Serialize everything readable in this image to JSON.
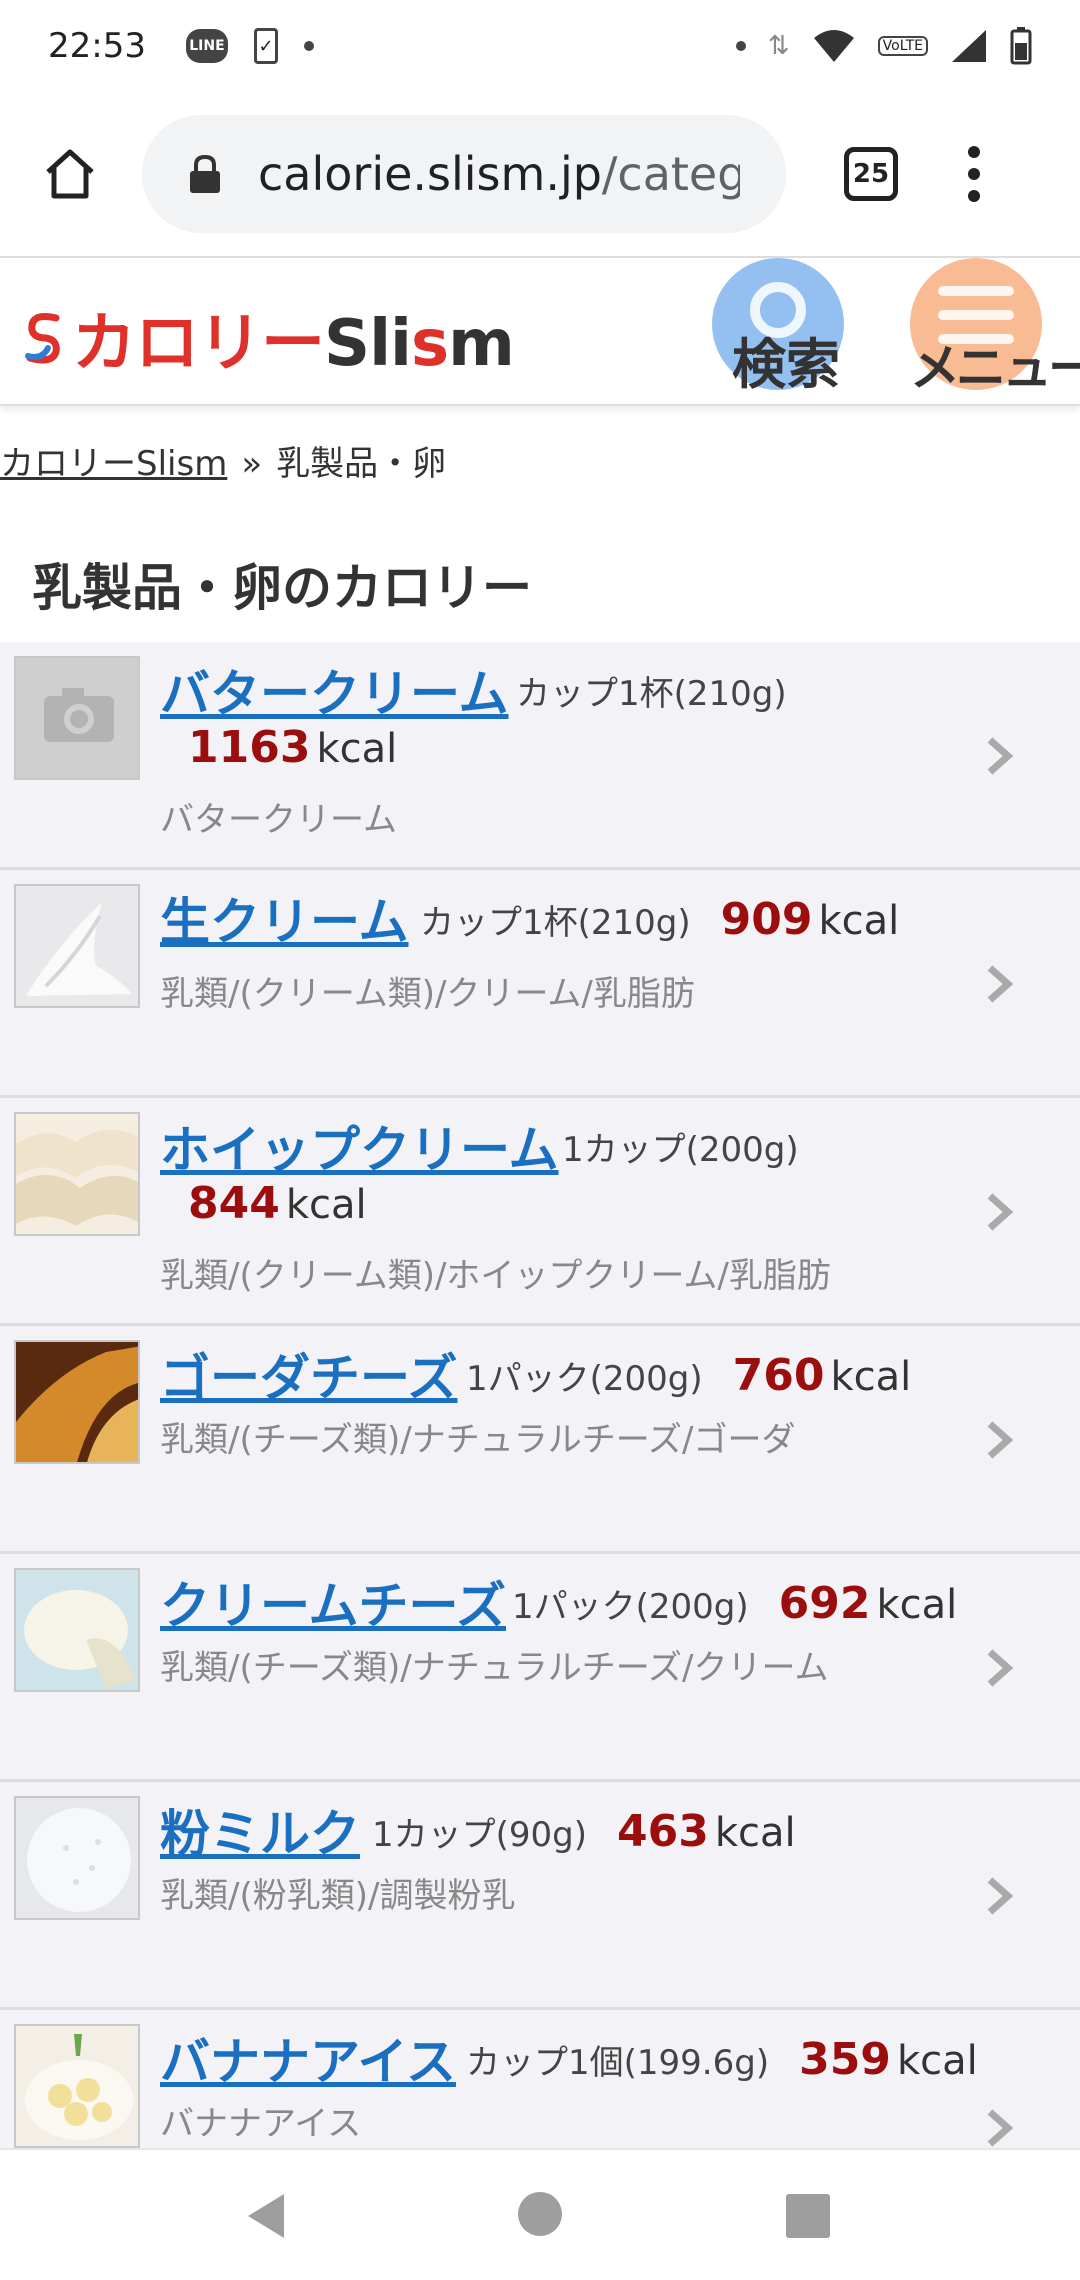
{
  "status_bar": {
    "time": "22:53",
    "icons": [
      "line-app-icon",
      "phone-check-icon",
      "dot-icon",
      "data-arrows-icon",
      "wifi-icon",
      "volte-icon",
      "signal-icon",
      "battery-icon"
    ],
    "volte_label": "VoLTE"
  },
  "browser": {
    "url_host": "calorie.slism.jp",
    "url_path": "/catego",
    "tab_count": "25"
  },
  "site": {
    "logo_kana": "カロリー",
    "logo_latin_pre": "Sli",
    "logo_latin_accent": "s",
    "logo_latin_post": "m",
    "search_label": "検索",
    "menu_label": "メニュー"
  },
  "breadcrumb": {
    "home": "カロリーSlism",
    "separator": "»",
    "current": "乳製品・卵"
  },
  "page_title": "乳製品・卵のカロリー",
  "items": [
    {
      "name": "バタークリーム",
      "portion": "カップ1杯(210g)",
      "kcal": "1163",
      "unit": "kcal",
      "desc": "バタークリーム"
    },
    {
      "name": "生クリーム",
      "portion": "カップ1杯(210g)",
      "kcal": "909",
      "unit": "kcal",
      "desc": "乳類/(クリーム類)/クリーム/乳脂肪"
    },
    {
      "name": "ホイップクリーム",
      "portion": "1カップ(200g)",
      "kcal": "844",
      "unit": "kcal",
      "desc": "乳類/(クリーム類)/ホイップクリーム/乳脂肪"
    },
    {
      "name": "ゴーダチーズ",
      "portion": "1パック(200g)",
      "kcal": "760",
      "unit": "kcal",
      "desc": "乳類/(チーズ類)/ナチュラルチーズ/ゴーダ"
    },
    {
      "name": "クリームチーズ",
      "portion": "1パック(200g)",
      "kcal": "692",
      "unit": "kcal",
      "desc": "乳類/(チーズ類)/ナチュラルチーズ/クリーム"
    },
    {
      "name": "粉ミルク",
      "portion": "1カップ(90g)",
      "kcal": "463",
      "unit": "kcal",
      "desc": "乳類/(粉乳類)/調製粉乳"
    },
    {
      "name": "バナナアイス",
      "portion": "カップ1個(199.6g)",
      "kcal": "359",
      "unit": "kcal",
      "desc": "バナナアイス"
    }
  ],
  "colors": {
    "link": "#1a6fc0",
    "kcal": "#9c0e0e",
    "list_bg": "#f3f3f7",
    "logo_red": "#e0302a"
  }
}
